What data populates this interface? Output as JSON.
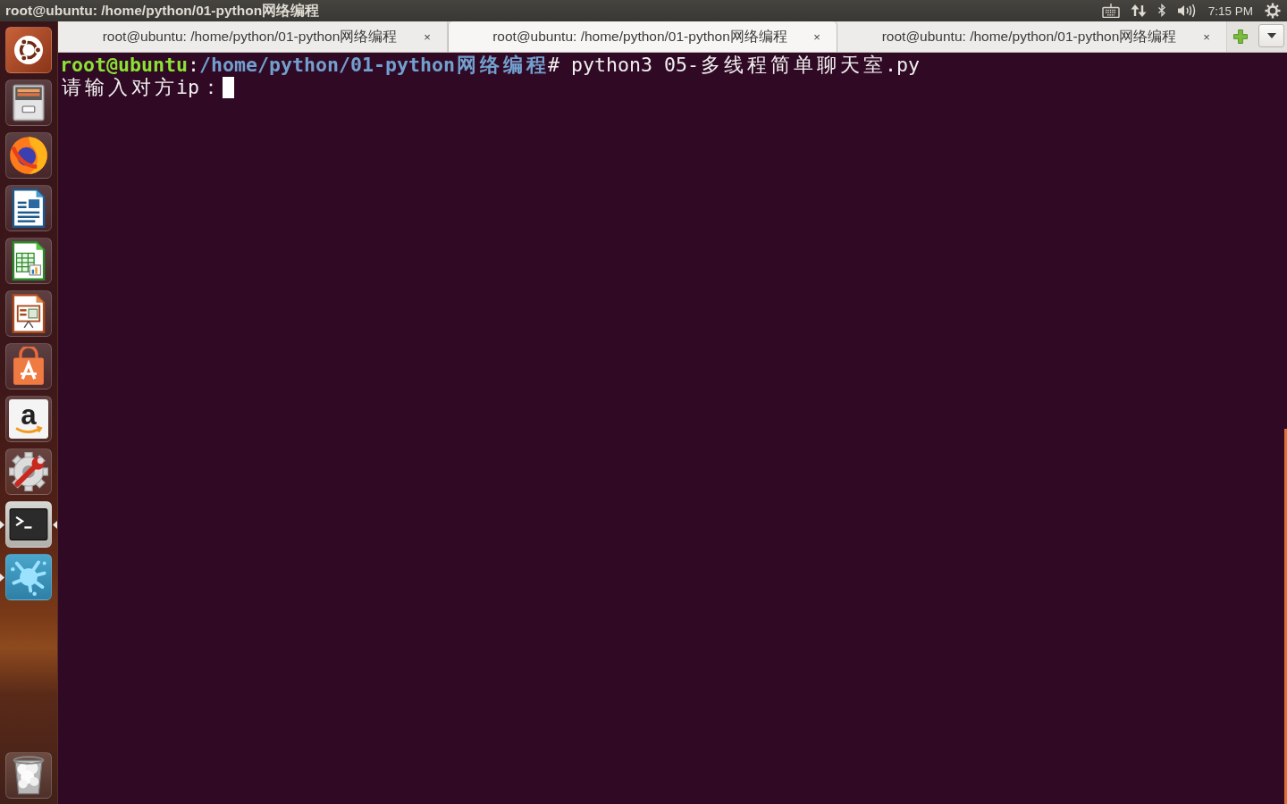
{
  "top_panel": {
    "title": "root@ubuntu: /home/python/01-python网络编程",
    "indicators": [
      {
        "kind": "keyboard"
      },
      {
        "kind": "network"
      },
      {
        "kind": "bluetooth"
      },
      {
        "kind": "volume"
      },
      {
        "kind": "clock",
        "text": "7:15 PM"
      },
      {
        "kind": "session"
      }
    ]
  },
  "launcher": {
    "items": [
      {
        "kind": "dash",
        "running": false,
        "focused": false
      },
      {
        "kind": "files",
        "running": false,
        "focused": false
      },
      {
        "kind": "browser",
        "running": false,
        "focused": false
      },
      {
        "kind": "writer",
        "running": false,
        "focused": false
      },
      {
        "kind": "calc",
        "running": false,
        "focused": false
      },
      {
        "kind": "impress",
        "running": false,
        "focused": false
      },
      {
        "kind": "store",
        "running": false,
        "focused": false
      },
      {
        "kind": "lettermark",
        "logo_text": "a",
        "running": false,
        "focused": false
      },
      {
        "kind": "settings",
        "running": false,
        "focused": false
      },
      {
        "kind": "terminal",
        "running": true,
        "focused": true
      },
      {
        "kind": "splash",
        "running": true,
        "focused": false
      }
    ],
    "bottom_items": [
      {
        "kind": "trash"
      }
    ]
  },
  "tabs": [
    {
      "label": "root@ubuntu: /home/python/01-python网络编程",
      "close": "×",
      "selected": false
    },
    {
      "label": "root@ubuntu: /home/python/01-python网络编程",
      "close": "×",
      "selected": true
    },
    {
      "label": "root@ubuntu: /home/python/01-python网络编程",
      "close": "×",
      "selected": false
    }
  ],
  "terminal": {
    "lines": [
      {
        "segments": [
          {
            "kind": "user",
            "text": "root@ubuntu"
          },
          {
            "kind": "plain",
            "text": ":"
          },
          {
            "kind": "path",
            "text": "/home/python/01-python网络编程"
          },
          {
            "kind": "plain",
            "text": "# python3 05-多线程简单聊天室.py"
          }
        ],
        "cursor": false
      },
      {
        "segments": [
          {
            "kind": "plain",
            "text": "请输入对方ip："
          }
        ],
        "cursor": true
      }
    ]
  }
}
